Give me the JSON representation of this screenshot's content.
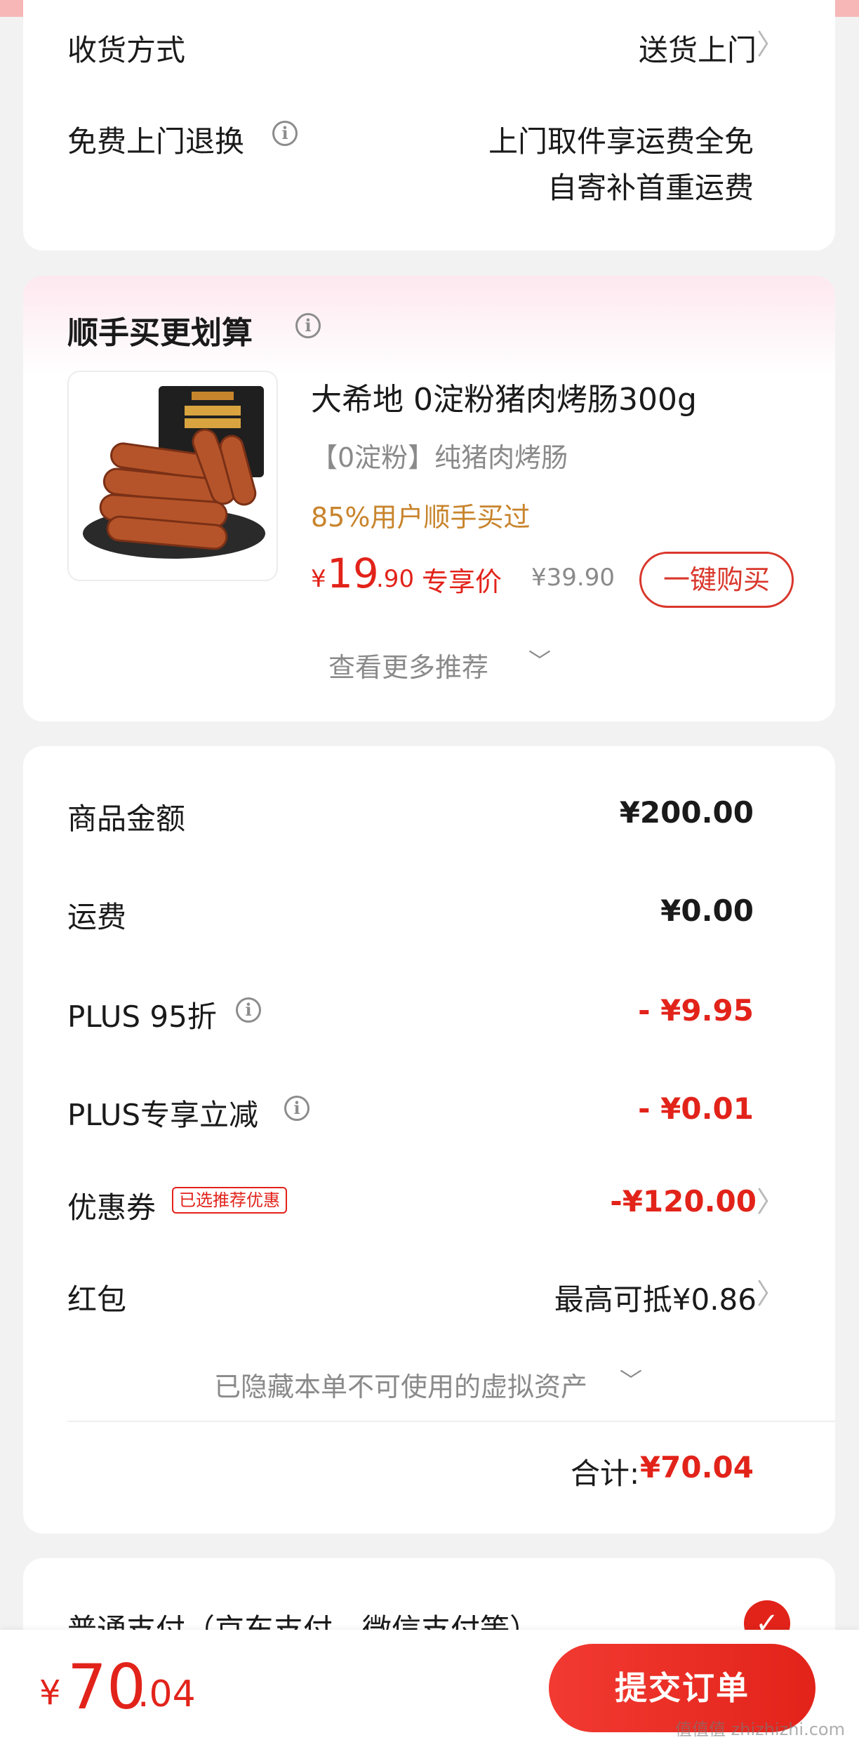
{
  "delivery": {
    "method_label": "收货方式",
    "method_value": "送货上门",
    "return_label": "免费上门退换",
    "return_value_line1": "上门取件享运费全免",
    "return_value_line2": "自寄补首重运费"
  },
  "recommend": {
    "title": "顺手买更划算",
    "product_name": "大希地 0淀粉猪肉烤肠300g",
    "product_sub": "【0淀粉】纯猪肉烤肠",
    "product_social": "85%用户顺手买过",
    "price_symbol": "¥",
    "price_int": "19",
    "price_dec": ".90",
    "price_tag": "专享价",
    "orig_price": "¥39.90",
    "buy_label": "一键购买",
    "more_label": "查看更多推荐"
  },
  "summary": {
    "goods_label": "商品金额",
    "goods_value": "¥200.00",
    "shipping_label": "运费",
    "shipping_value": "¥0.00",
    "plus_discount_label": "PLUS 95折",
    "plus_discount_value": "- ¥9.95",
    "plus_reduce_label": "PLUS专享立减",
    "plus_reduce_value": "- ¥0.01",
    "coupon_label": "优惠券",
    "coupon_tag": "已选推荐优惠",
    "coupon_value": "-¥120.00",
    "redpacket_label": "红包",
    "redpacket_value": "最高可抵¥0.86",
    "hidden_assets": "已隐藏本单不可使用的虚拟资产",
    "total_label": "合计:",
    "total_value": "¥70.04"
  },
  "payment": {
    "method": "普通支付（京东支付、微信支付等）"
  },
  "bottom": {
    "currency": "¥",
    "total_int": "70",
    "total_dec": ".04",
    "submit_label": "提交订单"
  },
  "watermark": "值值值 zhizhizhi.com",
  "colors": {
    "accent": "#e2231a",
    "orange": "#c8842c",
    "background": "#f2f2f2"
  }
}
